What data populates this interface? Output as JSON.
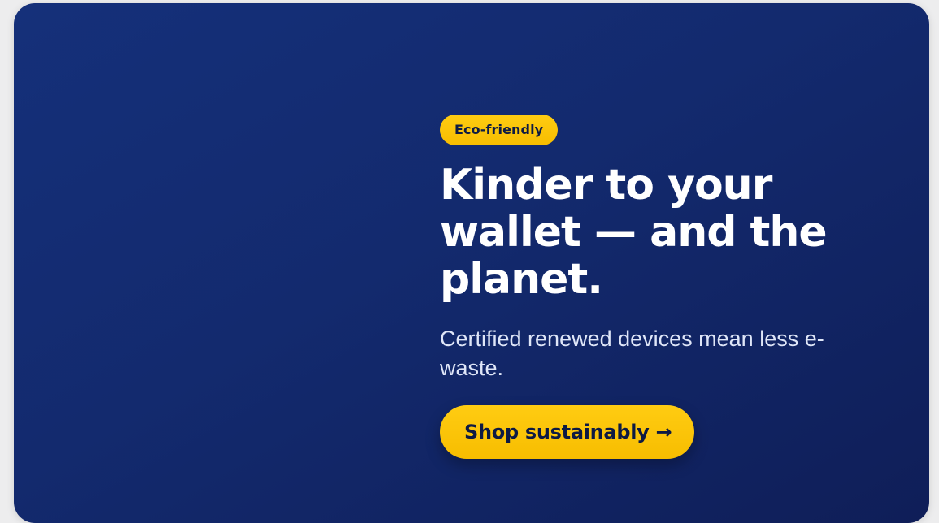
{
  "banner": {
    "badge": "Eco-friendly",
    "headline": "Kinder to your wallet — and the planet.",
    "subtext": "Certified renewed devices mean less e-waste.",
    "cta_label": "Shop sustainably →"
  },
  "colors": {
    "background": "#132a6e",
    "accent": "#f7bd00",
    "headline_text": "#ffffff",
    "button_text": "#0d1a44"
  }
}
